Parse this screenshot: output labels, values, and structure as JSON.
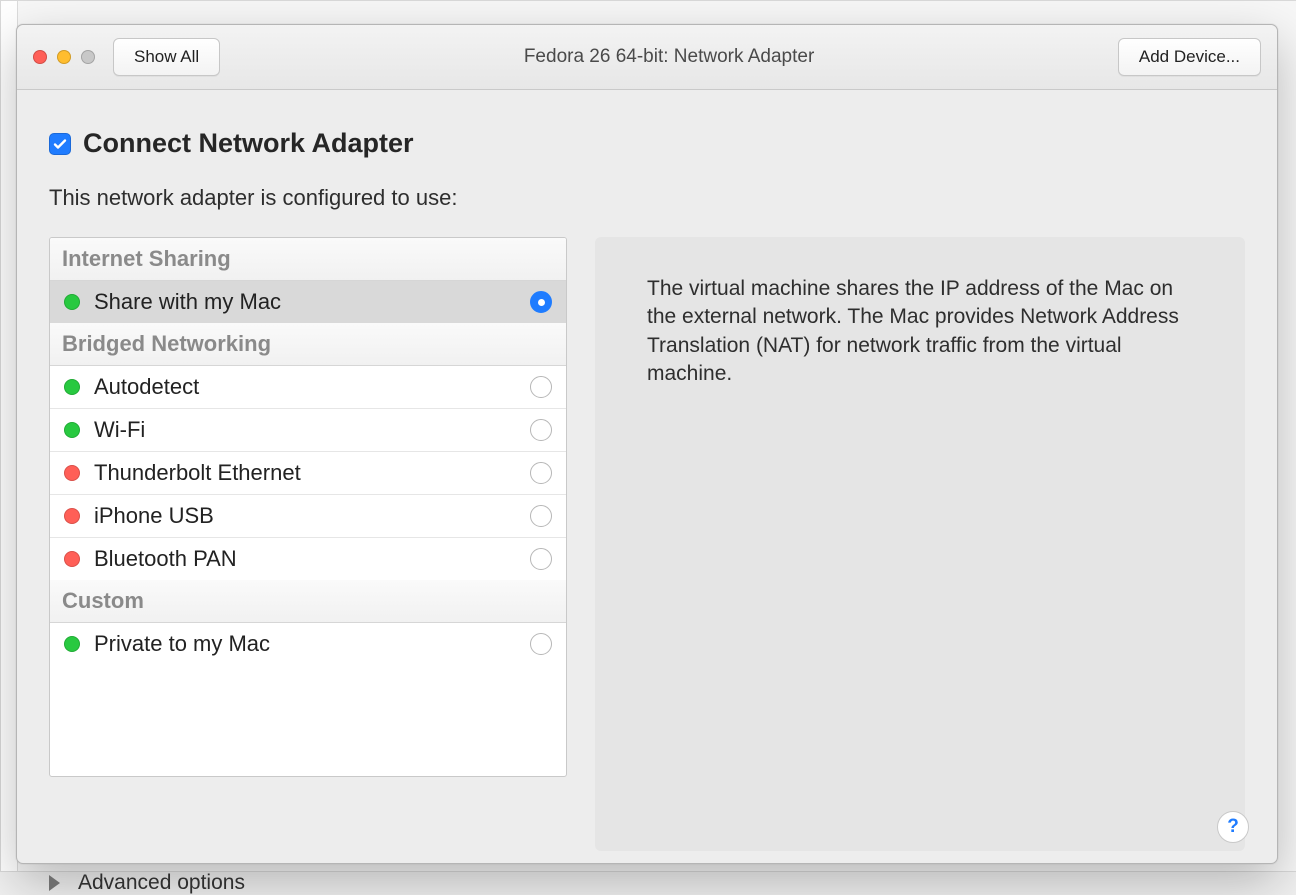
{
  "titlebar": {
    "show_all": "Show All",
    "title": "Fedora 26 64-bit: Network Adapter",
    "add_device": "Add Device..."
  },
  "header": {
    "checkbox_checked": true,
    "heading": "Connect Network Adapter",
    "subtitle": "This network adapter is configured to use:"
  },
  "groups": [
    {
      "label": "Internet Sharing",
      "options": [
        {
          "label": "Share with my Mac",
          "status": "green",
          "selected": true
        }
      ]
    },
    {
      "label": "Bridged Networking",
      "options": [
        {
          "label": "Autodetect",
          "status": "green",
          "selected": false
        },
        {
          "label": "Wi-Fi",
          "status": "green",
          "selected": false
        },
        {
          "label": "Thunderbolt Ethernet",
          "status": "red",
          "selected": false
        },
        {
          "label": "iPhone USB",
          "status": "red",
          "selected": false
        },
        {
          "label": "Bluetooth PAN",
          "status": "red",
          "selected": false
        }
      ]
    },
    {
      "label": "Custom",
      "options": [
        {
          "label": "Private to my Mac",
          "status": "green",
          "selected": false
        }
      ]
    }
  ],
  "description": "The virtual machine shares the IP address of the Mac on the external network. The Mac provides Network Address Translation (NAT) for network traffic from the virtual machine.",
  "advanced_label": "Advanced options",
  "help_label": "?"
}
